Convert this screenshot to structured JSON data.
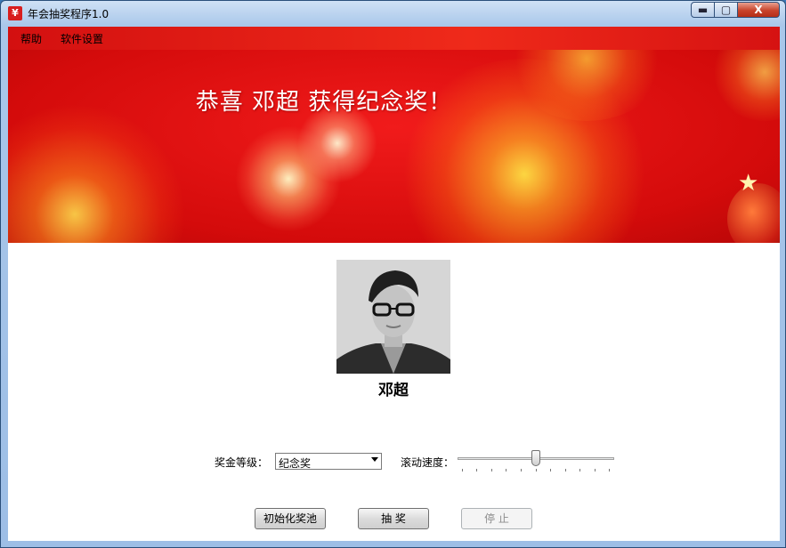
{
  "window": {
    "title": "年会抽奖程序1.0",
    "app_icon_glyph": "¥",
    "controls": {
      "minimize": "▬",
      "maximize": "▢",
      "close": "X"
    }
  },
  "menu": {
    "items": [
      {
        "label": "帮助"
      },
      {
        "label": "软件设置"
      }
    ]
  },
  "banner": {
    "headline": "恭喜  邓超  获得纪念奖！"
  },
  "winner": {
    "name": "邓超",
    "photo_icon": "portrait-photo"
  },
  "controls": {
    "prize_level_label": "奖金等级：",
    "prize_level_value": "纪念奖",
    "scroll_speed_label": "滚动速度：",
    "scroll_speed_level": 0.5
  },
  "buttons": {
    "init": "初始化奖池",
    "draw": "抽 奖",
    "stop": "停 止"
  },
  "colors": {
    "banner_red": "#e01414",
    "menu_red": "#d31010",
    "titlebar_blue": "#a9c7ea"
  }
}
